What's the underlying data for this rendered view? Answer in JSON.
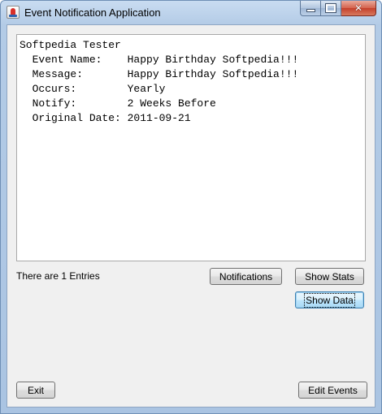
{
  "window": {
    "title": "Event Notification Application",
    "controls": {
      "minimize": "minimize-icon",
      "maximize": "maximize-icon",
      "close": "close-icon"
    }
  },
  "details": {
    "lines": [
      "Softpedia Tester",
      "  Event Name:    Happy Birthday Softpedia!!!",
      "  Message:       Happy Birthday Softpedia!!!",
      "  Occurs:        Yearly",
      "  Notify:        2 Weeks Before",
      "  Original Date: 2011-09-21"
    ]
  },
  "status": {
    "entries_text": "There are 1 Entries"
  },
  "buttons": {
    "notifications": "Notifications",
    "show_stats": "Show Stats",
    "show_data": "Show Data",
    "exit": "Exit",
    "edit_events": "Edit Events"
  },
  "colors": {
    "frame": "#b3cbe6",
    "client_bg": "#f0f0f0",
    "focus_button": "#bee6fd"
  }
}
